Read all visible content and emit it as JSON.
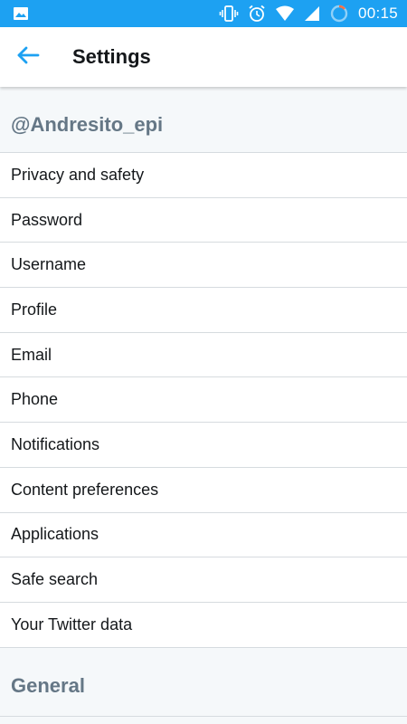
{
  "status_bar": {
    "time": "00:15",
    "icons": [
      "image-icon",
      "vibrate-icon",
      "alarm-icon",
      "wifi-icon",
      "signal-icon",
      "battery-charging-icon"
    ],
    "background_color": "#1da1f2"
  },
  "header": {
    "title": "Settings",
    "back_icon": "arrow-left-icon",
    "accent_color": "#1da1f2"
  },
  "account_section": {
    "heading": "@Andresito_epi",
    "items": [
      {
        "label": "Privacy and safety"
      },
      {
        "label": "Password"
      },
      {
        "label": "Username"
      },
      {
        "label": "Profile"
      },
      {
        "label": "Email"
      },
      {
        "label": "Phone"
      },
      {
        "label": "Notifications"
      },
      {
        "label": "Content preferences"
      },
      {
        "label": "Applications"
      },
      {
        "label": "Safe search"
      },
      {
        "label": "Your Twitter data"
      }
    ]
  },
  "general_section": {
    "heading": "General"
  }
}
